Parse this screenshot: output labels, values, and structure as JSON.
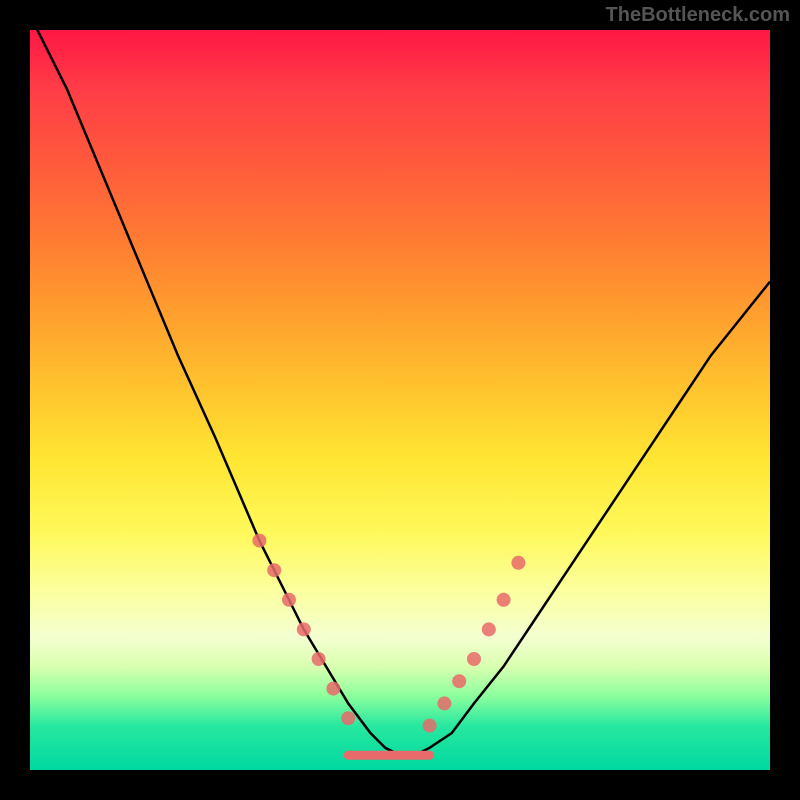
{
  "watermark": "TheBottleneck.com",
  "chart_data": {
    "type": "line",
    "title": "",
    "xlabel": "",
    "ylabel": "",
    "xlim": [
      0,
      100
    ],
    "ylim": [
      0,
      100
    ],
    "curve": {
      "x": [
        0,
        5,
        10,
        15,
        20,
        25,
        28,
        31,
        34,
        37,
        40,
        43,
        46,
        48,
        50,
        52,
        54,
        57,
        60,
        64,
        68,
        72,
        76,
        80,
        84,
        88,
        92,
        96,
        100
      ],
      "y": [
        102,
        92,
        80,
        68,
        56,
        45,
        38,
        31,
        25,
        19,
        14,
        9,
        5,
        3,
        2,
        2,
        3,
        5,
        9,
        14,
        20,
        26,
        32,
        38,
        44,
        50,
        56,
        61,
        66
      ]
    },
    "flat_segment": {
      "x": [
        43,
        54
      ],
      "y": 2
    },
    "dots_left": [
      {
        "x": 31,
        "y": 31
      },
      {
        "x": 33,
        "y": 27
      },
      {
        "x": 35,
        "y": 23
      },
      {
        "x": 37,
        "y": 19
      },
      {
        "x": 39,
        "y": 15
      },
      {
        "x": 41,
        "y": 11
      },
      {
        "x": 43,
        "y": 7
      }
    ],
    "dots_right": [
      {
        "x": 54,
        "y": 6
      },
      {
        "x": 56,
        "y": 9
      },
      {
        "x": 58,
        "y": 12
      },
      {
        "x": 60,
        "y": 15
      },
      {
        "x": 62,
        "y": 19
      },
      {
        "x": 64,
        "y": 23
      },
      {
        "x": 66,
        "y": 28
      }
    ],
    "gradient_stops": [
      {
        "pos": 0,
        "color": "#ff1744"
      },
      {
        "pos": 50,
        "color": "#ffe633"
      },
      {
        "pos": 90,
        "color": "#8cff9d"
      },
      {
        "pos": 100,
        "color": "#00d8a0"
      }
    ]
  }
}
